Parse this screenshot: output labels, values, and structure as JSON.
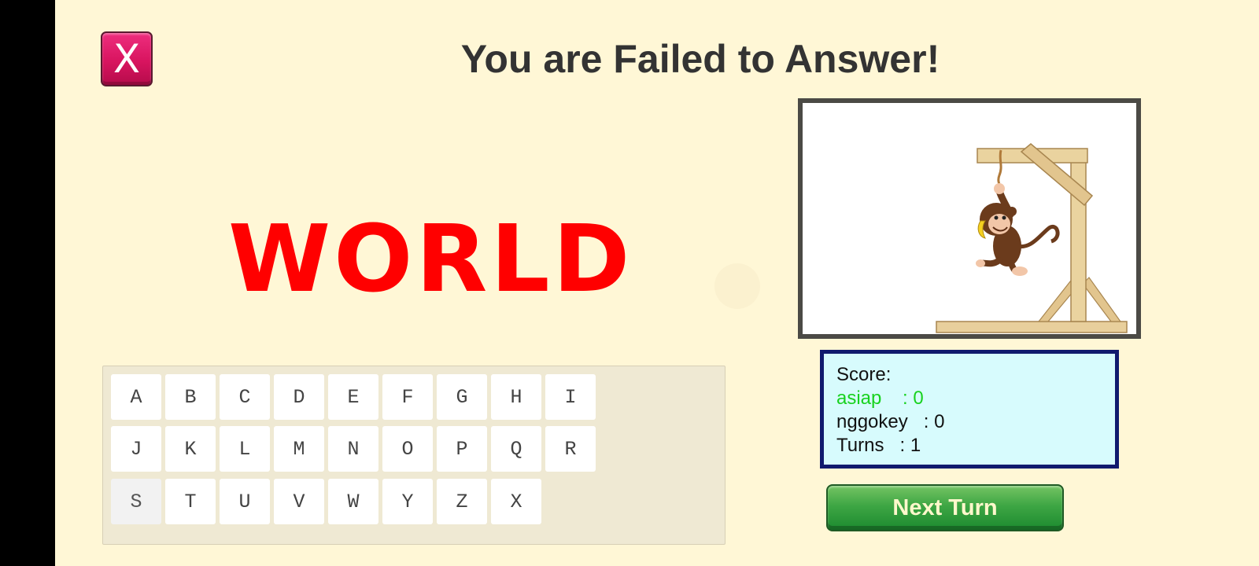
{
  "title": "You are Failed to Answer!",
  "close_button": {
    "label": "X"
  },
  "answer_word": "WORLD",
  "keyboard": {
    "rows": [
      [
        "A",
        "B",
        "C",
        "D",
        "E",
        "F",
        "G",
        "H",
        "I"
      ],
      [
        "J",
        "K",
        "L",
        "M",
        "N",
        "O",
        "P",
        "Q",
        "R"
      ],
      [
        "S",
        "T",
        "U",
        "V",
        "W",
        "Y",
        "Z",
        "X"
      ]
    ],
    "used_letters": [
      "S"
    ]
  },
  "score": {
    "heading": "Score:",
    "players": [
      {
        "name": "asiap",
        "value": "0",
        "highlight": true
      },
      {
        "name": "nggokey",
        "value": "0",
        "highlight": false
      }
    ],
    "turns_label": "Turns",
    "turns_value": "1"
  },
  "next_turn_label": "Next Turn",
  "colors": {
    "background": "#fff7d6",
    "answer": "#ff0000",
    "player_highlight": "#18d21f",
    "score_bg": "#d7fbfd",
    "score_border": "#101a6e",
    "close_button": "#d8145f",
    "next_button": "#2f9b3c"
  },
  "icons": {
    "illustration": "monkey-on-gallows"
  }
}
